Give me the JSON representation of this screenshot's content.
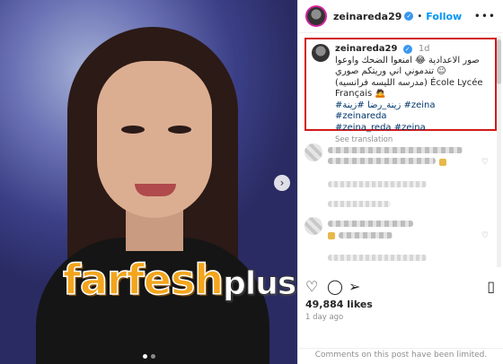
{
  "post": {
    "username": "zeinareda29",
    "separator": "•",
    "follow_label": "Follow",
    "more_label": "•••"
  },
  "caption": {
    "username": "zeinareda29",
    "time": "1d",
    "line1": "صور الاعدادية 😂 امنعوا الضحك واوعوا",
    "line2": "تندموني اني وريتكم صوري ☺",
    "line3": "(مدرسه الليسه فرانسيه) École Lycée",
    "line4": "Français 🙇",
    "hashtags_line1": "#زينة_رضا #زينة #zeina #zeinareda",
    "hashtags_line2": "#zeina_reda #zeina",
    "see_translation": "See translation"
  },
  "photo": {
    "watermark_main": "farfesh",
    "watermark_sub": "plus.com",
    "next_icon": "›"
  },
  "carousel": {
    "slides": 2,
    "active_index": 0
  },
  "stats": {
    "likes": "49,884 likes",
    "time_ago": "1 day ago",
    "comments_notice": "Comments on this post have been limited."
  },
  "icons": [
    "heart-icon",
    "comment-icon",
    "share-icon",
    "bookmark-icon",
    "verified-icon",
    "next-arrow-icon"
  ],
  "colors": {
    "follow": "#0095f6",
    "highlight_box": "#d11a1a",
    "hashtag": "#00376b",
    "watermark": "#f3a51c"
  }
}
